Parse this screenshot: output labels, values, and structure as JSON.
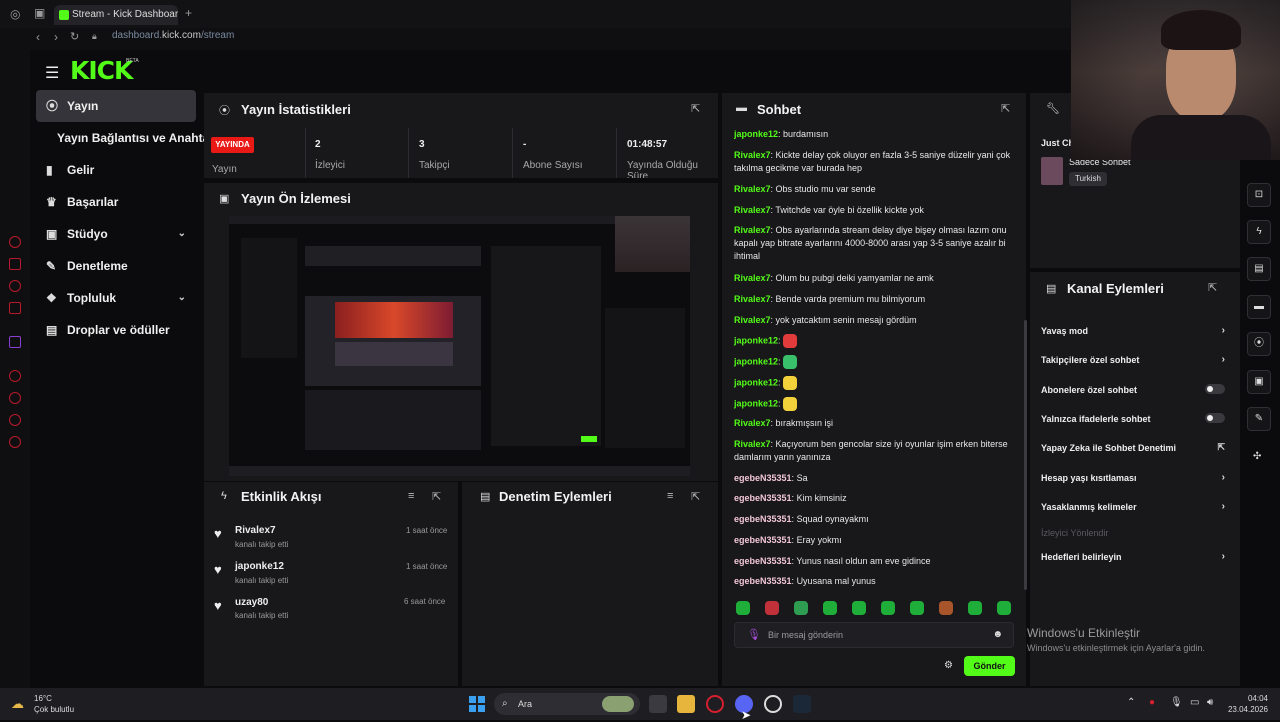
{
  "browser": {
    "tab_title": "Stream - Kick Dashboard",
    "url_host": "dashboard.",
    "url_domain": "kick.com",
    "url_path": "/stream"
  },
  "header": {
    "logo": "KICK",
    "beta": "BETA"
  },
  "nav": {
    "items": [
      {
        "label": "Yayın",
        "active": true
      },
      {
        "label": "Yayın Bağlantısı ve Anahtarı"
      },
      {
        "label": "Gelir"
      },
      {
        "label": "Başarılar"
      },
      {
        "label": "Stüdyo"
      },
      {
        "label": "Denetleme"
      },
      {
        "label": "Topluluk"
      },
      {
        "label": "Droplar ve ödüller"
      }
    ]
  },
  "stats": {
    "title": "Yayın İstatistikleri",
    "live_badge": "YAYINDA",
    "live_label": "Yayın",
    "items": [
      {
        "value": "2",
        "label": "İzleyici"
      },
      {
        "value": "3",
        "label": "Takipçi"
      },
      {
        "value": "-",
        "label": "Abone Sayısı"
      },
      {
        "value": "01:48:57",
        "label": "Yayında Olduğu Süre"
      }
    ]
  },
  "preview": {
    "title": "Yayın Ön İzlemesi"
  },
  "activity": {
    "title": "Etkinlik Akışı",
    "items": [
      {
        "name": "Rivalex7",
        "sub": "kanalı takip etti",
        "time": "1 saat önce"
      },
      {
        "name": "japonke12",
        "sub": "kanalı takip etti",
        "time": "1 saat önce"
      },
      {
        "name": "uzay80",
        "sub": "kanalı takip etti",
        "time": "6 saat önce"
      }
    ]
  },
  "moderation": {
    "title": "Denetim Eylemleri"
  },
  "chat": {
    "title": "Sohbet",
    "messages": [
      {
        "user": "japonke12",
        "text": "burdamısın",
        "color": "#53fc18"
      },
      {
        "user": "Rivalex7",
        "text": "Kickte delay çok oluyor en fazla 3-5 saniye düzelir yani çok takılma gecikme var burada hep",
        "color": "#53fc18"
      },
      {
        "user": "Rivalex7",
        "text": "Obs studio mu var sende",
        "color": "#53fc18"
      },
      {
        "user": "Rivalex7",
        "text": "Twitchde var öyle bi özellik kickte yok",
        "color": "#53fc18"
      },
      {
        "user": "Rivalex7",
        "text": "Obs ayarlarında stream delay diye bişey olması lazım onu kapalı yap bitrate ayarlarını 4000-8000 arası yap 3-5 saniye azalır bi ihtimal",
        "color": "#53fc18"
      },
      {
        "user": "Rivalex7",
        "text": "Olum bu pubgi deiki yamyamlar ne amk",
        "color": "#53fc18"
      },
      {
        "user": "Rivalex7",
        "text": "Bende varda premium mu bilmiyorum",
        "color": "#53fc18"
      },
      {
        "user": "Rivalex7",
        "text": "yok yatcaktım senin mesajı gördüm",
        "color": "#53fc18"
      },
      {
        "user": "japonke12",
        "text": "",
        "color": "#53fc18",
        "emote": "#e23b3b"
      },
      {
        "user": "japonke12",
        "text": "",
        "color": "#53fc18",
        "emote": "#39c06a"
      },
      {
        "user": "japonke12",
        "text": "",
        "color": "#53fc18",
        "emote": "#f2d13b"
      },
      {
        "user": "japonke12",
        "text": "",
        "color": "#53fc18",
        "emote": "#f2d13b"
      },
      {
        "user": "Rivalex7",
        "text": "bırakmışsın işi",
        "color": "#53fc18"
      },
      {
        "user": "Rivalex7",
        "text": "Kaçıyorum ben gencolar size iyi oyunlar işim erken biterse damlarım yarın yanınıza",
        "color": "#53fc18"
      },
      {
        "user": "egebeN35351",
        "text": "Sa",
        "color": "#f2c6d6"
      },
      {
        "user": "egebeN35351",
        "text": "Kim kimsiniz",
        "color": "#f2c6d6"
      },
      {
        "user": "egebeN35351",
        "text": "Squad oynayakmı",
        "color": "#f2c6d6"
      },
      {
        "user": "egebeN35351",
        "text": "Eray yokmı",
        "color": "#f2c6d6"
      },
      {
        "user": "egebeN35351",
        "text": "Yunus nasıl oldun am eve gidince",
        "color": "#f2c6d6"
      },
      {
        "user": "egebeN35351",
        "text": "Uyusana mal yunus",
        "color": "#f2c6d6"
      }
    ],
    "input_placeholder": "Bir mesaj gönderin",
    "send_label": "Gönder"
  },
  "side_panel": {
    "title_partial": "Just Ch",
    "chat_mode": "Sadece Sohbet",
    "language_badge": "Turkish"
  },
  "channel_actions": {
    "title": "Kanal Eylemleri",
    "items": [
      {
        "label": "Yavaş mod",
        "kind": "arrow"
      },
      {
        "label": "Takipçilere özel sohbet",
        "kind": "arrow"
      },
      {
        "label": "Abonelere özel sohbet",
        "kind": "toggle"
      },
      {
        "label": "Yalnızca ifadelerle sohbet",
        "kind": "toggle"
      },
      {
        "label": "Yapay Zeka ile Sohbet Denetimi",
        "kind": "external"
      },
      {
        "label": "Hesap yaşı kısıtlaması",
        "kind": "arrow"
      },
      {
        "label": "Yasaklanmış kelimeler",
        "kind": "arrow"
      },
      {
        "label": "İzleyici Yönlendir",
        "kind": "disabled"
      },
      {
        "label": "Hedefleri belirleyin",
        "kind": "arrow"
      }
    ]
  },
  "windows": {
    "watermark_title": "Windows'u Etkinleştir",
    "watermark_sub": "Windows'u etkinleştirmek için Ayarlar'a gidin.",
    "weather_temp": "16°C",
    "weather_desc": "Çok bulutlu",
    "search_label": "Ara",
    "time": "04:04",
    "date": "23.04.2026"
  },
  "colors": {
    "accent": "#53fc18",
    "live": "#e91916",
    "panel": "#18181b"
  }
}
